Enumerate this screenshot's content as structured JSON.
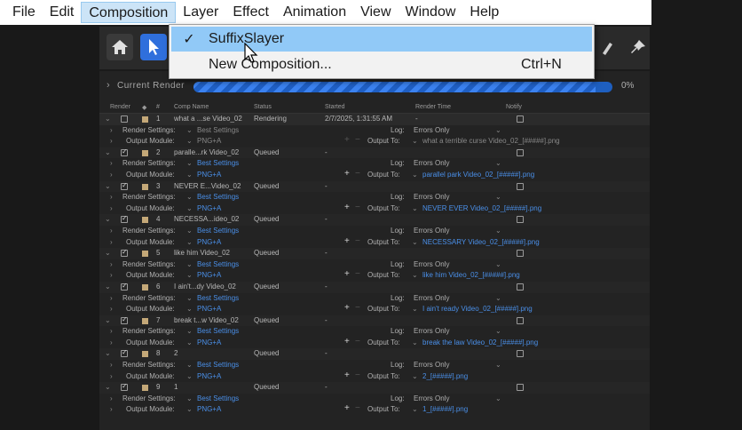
{
  "menubar": {
    "items": [
      "File",
      "Edit",
      "Composition",
      "Layer",
      "Effect",
      "Animation",
      "View",
      "Window",
      "Help"
    ],
    "active_index": 2
  },
  "dropdown": {
    "items": [
      {
        "label": "SuffixSlayer",
        "checked": "✓",
        "shortcut": ""
      },
      {
        "label": "New Composition...",
        "checked": "",
        "shortcut": "Ctrl+N"
      }
    ]
  },
  "current_render": {
    "label": "Current Render",
    "percent_text": "0%",
    "progress_fraction": 0.96
  },
  "columns": {
    "render": "Render",
    "hash": "#",
    "comp_name": "Comp Name",
    "status": "Status",
    "started": "Started",
    "render_time": "Render Time",
    "notify": "Notify"
  },
  "labels": {
    "render_settings": "Render Settings:",
    "output_module": "Output Module:",
    "log": "Log:",
    "output_to": "Output To:"
  },
  "queue": [
    {
      "num": "1",
      "comp": "what a ...se Video_02",
      "status": "Rendering",
      "started": "2/7/2025, 1:31:55 AM",
      "render_time": "-",
      "settings": "Best Settings",
      "module": "PNG+A",
      "log": "Errors Only",
      "output": "what a terrible curse Video_02_[#####].png",
      "checked": false
    },
    {
      "num": "2",
      "comp": "paralle...rk Video_02",
      "status": "Queued",
      "started": "-",
      "render_time": "",
      "settings": "Best Settings",
      "module": "PNG+A",
      "log": "Errors Only",
      "output": "parallel park Video_02_[#####].png",
      "checked": true
    },
    {
      "num": "3",
      "comp": "NEVER E...Video_02",
      "status": "Queued",
      "started": "-",
      "render_time": "",
      "settings": "Best Settings",
      "module": "PNG+A",
      "log": "Errors Only",
      "output": "NEVER EVER Video_02_[#####].png",
      "checked": true
    },
    {
      "num": "4",
      "comp": "NECESSA...ideo_02",
      "status": "Queued",
      "started": "-",
      "render_time": "",
      "settings": "Best Settings",
      "module": "PNG+A",
      "log": "Errors Only",
      "output": "NECESSARY Video_02_[#####].png",
      "checked": true
    },
    {
      "num": "5",
      "comp": "like him Video_02",
      "status": "Queued",
      "started": "-",
      "render_time": "",
      "settings": "Best Settings",
      "module": "PNG+A",
      "log": "Errors Only",
      "output": "like him Video_02_[#####].png",
      "checked": true
    },
    {
      "num": "6",
      "comp": "I ain't...dy Video_02",
      "status": "Queued",
      "started": "-",
      "render_time": "",
      "settings": "Best Settings",
      "module": "PNG+A",
      "log": "Errors Only",
      "output": "I ain't ready Video_02_[#####].png",
      "checked": true
    },
    {
      "num": "7",
      "comp": "break t...w Video_02",
      "status": "Queued",
      "started": "-",
      "render_time": "",
      "settings": "Best Settings",
      "module": "PNG+A",
      "log": "Errors Only",
      "output": "break the law Video_02_[#####].png",
      "checked": true
    },
    {
      "num": "8",
      "comp": "2",
      "status": "Queued",
      "started": "-",
      "render_time": "",
      "settings": "Best Settings",
      "module": "PNG+A",
      "log": "Errors Only",
      "output": "2_[#####].png",
      "checked": true
    },
    {
      "num": "9",
      "comp": "1",
      "status": "Queued",
      "started": "-",
      "render_time": "",
      "settings": "Best Settings",
      "module": "PNG+A",
      "log": "Errors Only",
      "output": "1_[#####].png",
      "checked": true
    }
  ],
  "colors": {
    "accent_blue": "#2f6fdc",
    "link_blue": "#4a8fe8",
    "menu_highlight": "#91c9f7",
    "label_tan": "#c4a878"
  }
}
